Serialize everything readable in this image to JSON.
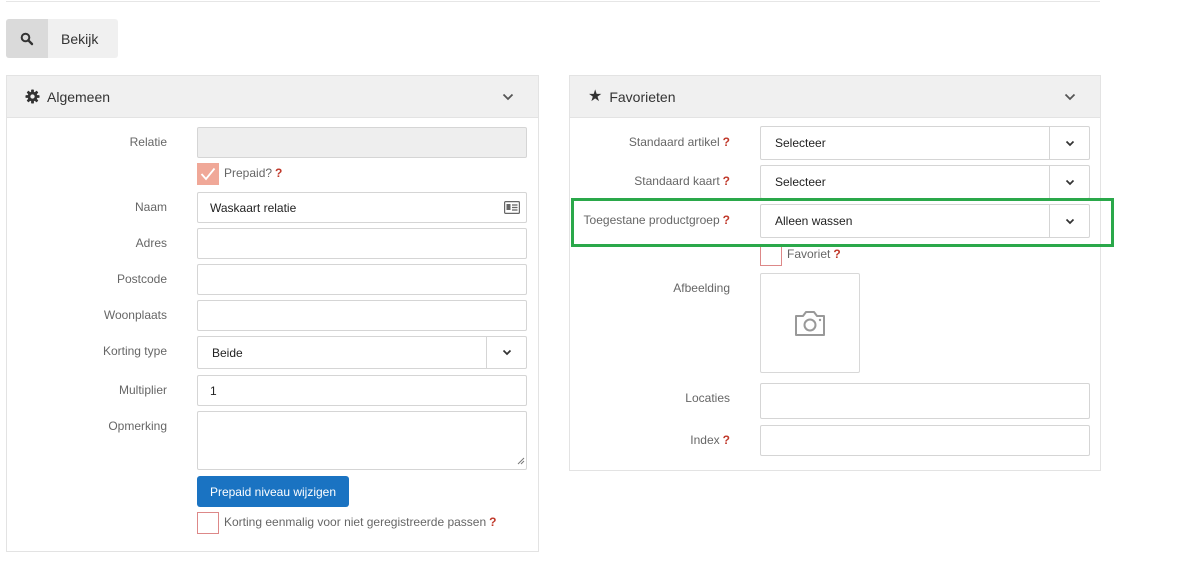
{
  "toolbar": {
    "view_label": "Bekijk",
    "view_icon": "search-icon"
  },
  "general": {
    "title": "Algemeen",
    "relation_label": "Relatie",
    "relation_value": "",
    "prepaid_label": "Prepaid?",
    "prepaid_checked": true,
    "name_label": "Naam",
    "name_value": "Waskaart relatie",
    "address_label": "Adres",
    "address_value": "",
    "postcode_label": "Postcode",
    "postcode_value": "",
    "city_label": "Woonplaats",
    "city_value": "",
    "discount_type_label": "Korting type",
    "discount_type_value": "Beide",
    "multiplier_label": "Multiplier",
    "multiplier_value": "1",
    "remark_label": "Opmerking",
    "remark_value": "",
    "prepaid_level_button": "Prepaid niveau wijzigen",
    "one_time_discount_label": "Korting eenmalig voor niet geregistreerde passen",
    "one_time_discount_checked": false
  },
  "favorites": {
    "title": "Favorieten",
    "default_article_label": "Standaard artikel",
    "default_article_value": "Selecteer",
    "default_card_label": "Standaard kaart",
    "default_card_value": "Selecteer",
    "allowed_group_label": "Toegestane productgroep",
    "allowed_group_value": "Alleen wassen",
    "favorite_label": "Favoriet",
    "favorite_checked": false,
    "image_label": "Afbeelding",
    "locations_label": "Locaties",
    "locations_value": "",
    "index_label": "Index",
    "index_value": ""
  },
  "help_mark": "?",
  "colors": {
    "accent": "#1a73c2",
    "highlight": "#2aa84a",
    "help": "#c0392b",
    "checked": "#f0a898"
  }
}
